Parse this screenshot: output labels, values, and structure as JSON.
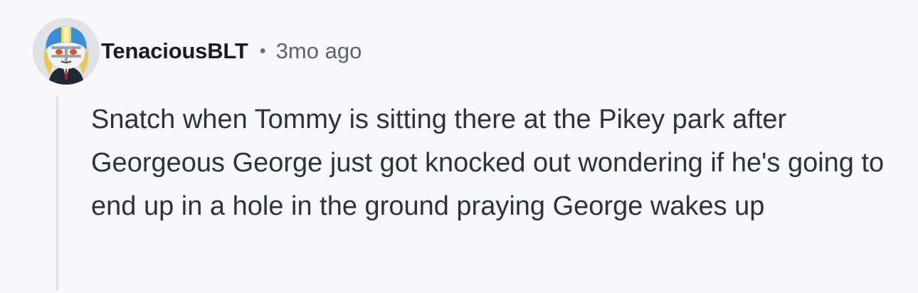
{
  "comment": {
    "author": "TenaciousBLT",
    "separator": "•",
    "timestamp": "3mo ago",
    "avatar_icon": "snoo-football-helmet-avatar",
    "text": "Snatch when Tommy is sitting there at the Pikey park after Georgeous George just got knocked out wondering if he's going to end up in a hole in the ground praying George wakes up"
  },
  "colors": {
    "background": "#f8f8fa",
    "author": "#1a1c1e",
    "timestamp": "#5f6368",
    "body_text": "#2f3336",
    "thread_line": "#dedfe2"
  }
}
